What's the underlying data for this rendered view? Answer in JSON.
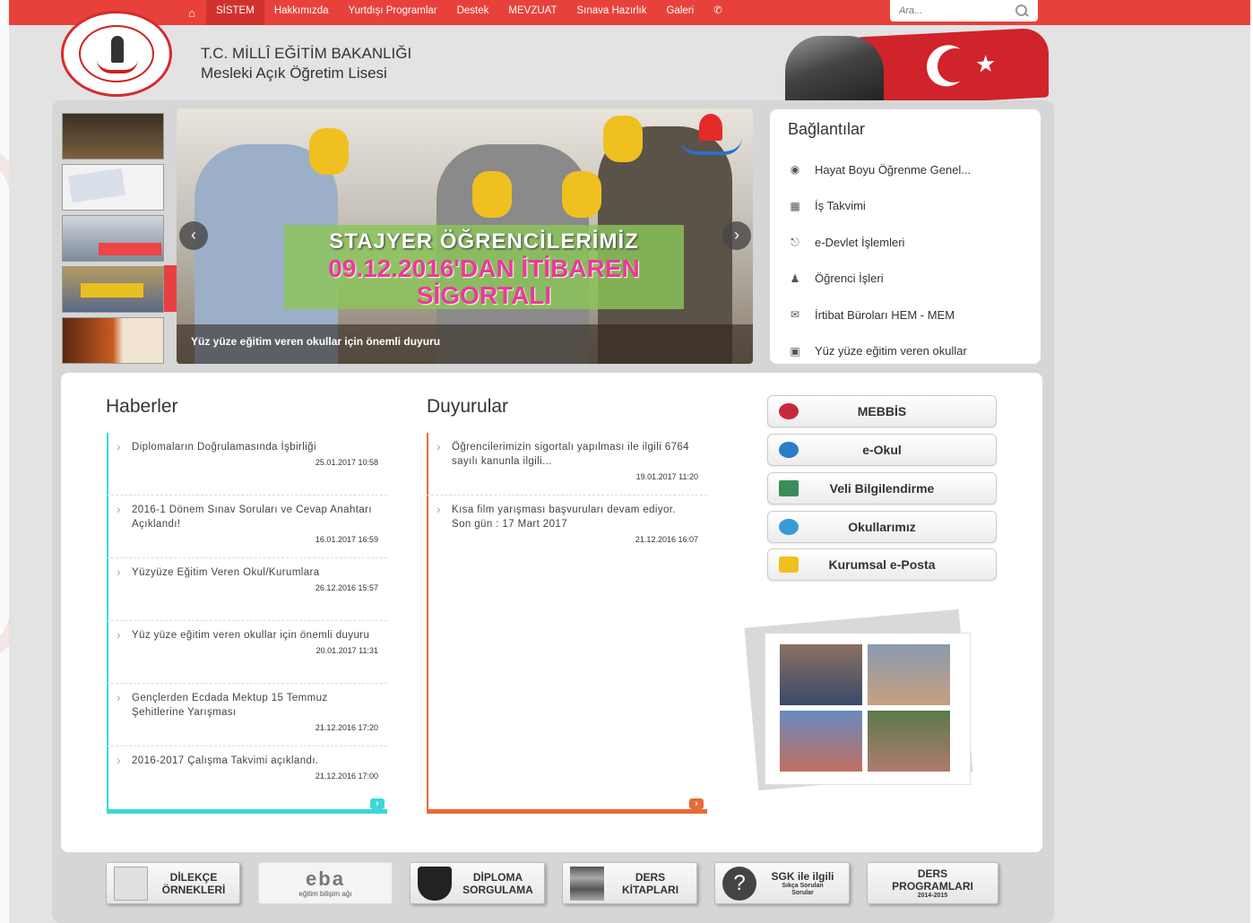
{
  "nav": {
    "items": [
      "SİSTEM",
      "Hakkımızda",
      "Yurtdışı Programlar",
      "Destek",
      "MEVZUAT",
      "Sınava Hazırlık",
      "Galeri"
    ],
    "search_placeholder": "Ara..."
  },
  "header": {
    "title_line1": "T.C. MİLLÎ EĞİTİM BAKANLIĞI",
    "title_line2": "Mesleki Açık Öğretim Lisesi"
  },
  "slider": {
    "headline1": "STAJYER ÖĞRENCİLERİMİZ",
    "headline2": "09.12.2016'DAN İTİBAREN",
    "headline3": "SİGORTALI",
    "caption": "Yüz yüze eğitim veren okullar için önemli duyuru"
  },
  "links": {
    "title": "Bağlantılar",
    "items": [
      {
        "label": "Hayat Boyu Öğrenme Genel...",
        "icon": "globe-icon"
      },
      {
        "label": "İş Takvimi",
        "icon": "calendar-icon"
      },
      {
        "label": "e-Devlet İşlemleri",
        "icon": "institution-icon"
      },
      {
        "label": "Öğrenci İşleri",
        "icon": "users-icon"
      },
      {
        "label": "İrtibat Büroları HEM - MEM",
        "icon": "envelope-icon"
      },
      {
        "label": "Yüz yüze eğitim veren okullar",
        "icon": "bus-icon"
      }
    ]
  },
  "haberler": {
    "title": "Haberler",
    "items": [
      {
        "text": "Diplomaların Doğrulamasında İşbirliği",
        "date": "25.01.2017 10:58"
      },
      {
        "text": "2016-1 Dönem Sınav Soruları ve Cevap Anahtarı Açıklandı!",
        "date": "16.01.2017 16:59"
      },
      {
        "text": "Yüzyüze Eğitim Veren Okul/Kurumlara",
        "date": "26.12.2016 15:57"
      },
      {
        "text": "Yüz yüze eğitim veren okullar için önemli duyuru",
        "date": "20.01.2017 11:31"
      },
      {
        "text": "Gençlerden Ecdada Mektup 15 Temmuz Şehitlerine Yarışması",
        "date": "21.12.2016 17:20"
      },
      {
        "text": "2016-2017 Çalışma Takvimi açıklandı.",
        "date": "21.12.2016 17:00"
      }
    ]
  },
  "duyurular": {
    "title": "Duyurular",
    "items": [
      {
        "text": "Öğrencilerimizin sigortalı yapılması ile ilgili 6764 sayılı kanunla ilgili...",
        "date": "19.01.2017 11:20"
      },
      {
        "text": "Kısa film yarışması başvuruları devam ediyor. Son gün : 17 Mart 2017",
        "date": "21.12.2016 16:07"
      }
    ]
  },
  "quick_links": [
    "MEBBİS",
    "e-Okul",
    "Veli Bilgilendirme",
    "Okullarımız",
    "Kurumsal e-Posta"
  ],
  "banners": {
    "dilekce": {
      "line1": "DİLEKÇE",
      "line2": "ÖRNEKLERİ"
    },
    "eba": {
      "logo": "eba",
      "sub": "eğitim bilişim ağı"
    },
    "diploma": {
      "line1": "DİPLOMA",
      "line2": "SORGULAMA"
    },
    "ders_kitaplari": {
      "line1": "DERS",
      "line2": "KİTAPLARI"
    },
    "sgk": {
      "line1": "SGK ile ilgili",
      "sub1": "Sıkça Sorulan",
      "sub2": "Sorular"
    },
    "ders_programlari": {
      "line1": "DERS",
      "line2": "PROGRAMLARI",
      "sub": "2014-2015"
    }
  },
  "colors": {
    "nav_red": "#e8413b",
    "haberler_accent": "#3ad6d8",
    "duyurular_accent": "#e86a3a"
  }
}
